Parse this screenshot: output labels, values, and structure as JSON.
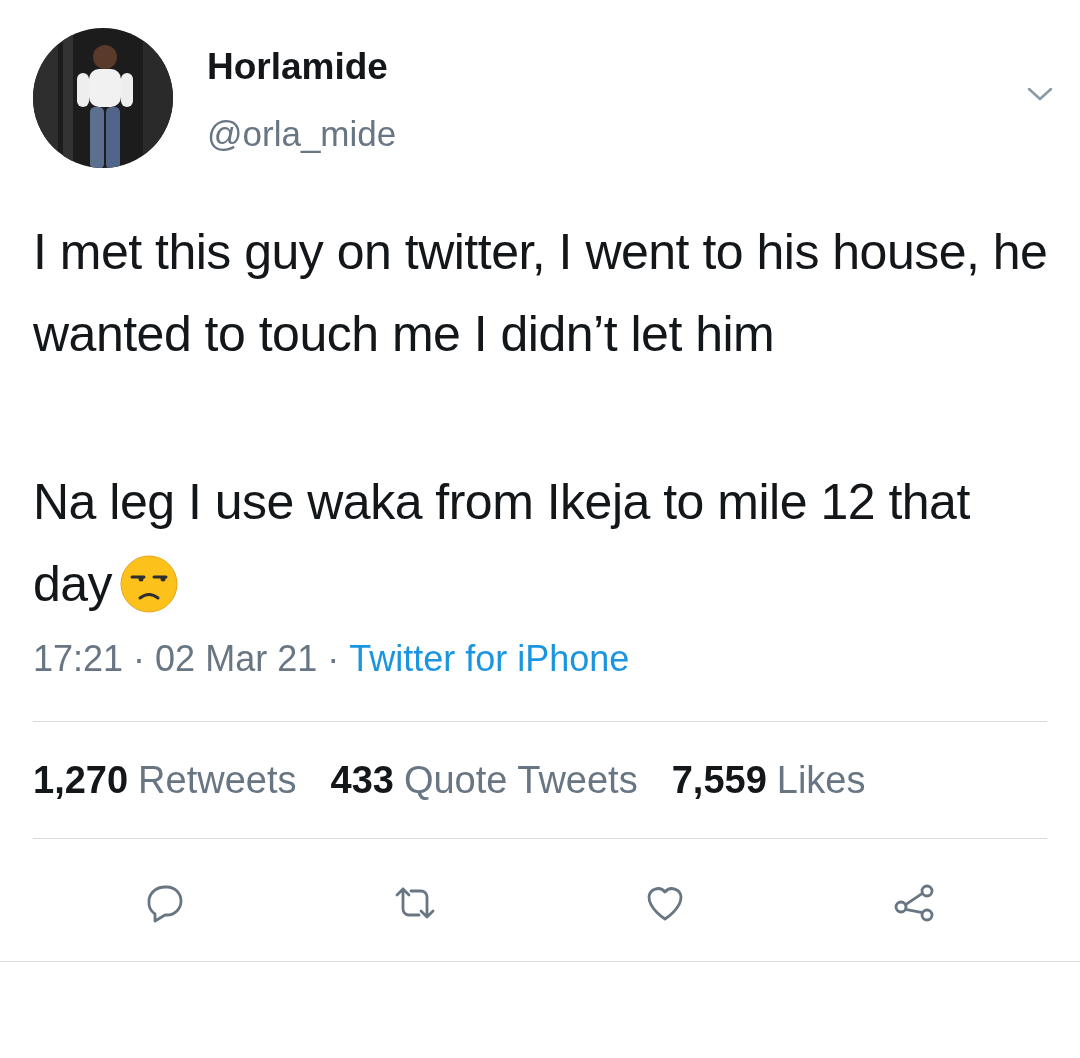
{
  "author": {
    "name": "Horlamide",
    "handle": "@orla_mide"
  },
  "tweet": {
    "paragraphs": [
      "I met this guy on twitter, I went to his house, he wanted to touch me I didn’t let him",
      "Na leg I use waka from Ikeja to mile 12 that day"
    ]
  },
  "meta": {
    "time": "17:21",
    "separator": "·",
    "date": "02 Mar 21",
    "source": "Twitter for iPhone"
  },
  "stats": [
    {
      "count": "1,270",
      "label": "Retweets"
    },
    {
      "count": "433",
      "label": "Quote Tweets"
    },
    {
      "count": "7,559",
      "label": "Likes"
    }
  ],
  "actions": [
    {
      "kind": "reply"
    },
    {
      "kind": "retweet"
    },
    {
      "kind": "like"
    },
    {
      "kind": "share"
    }
  ]
}
